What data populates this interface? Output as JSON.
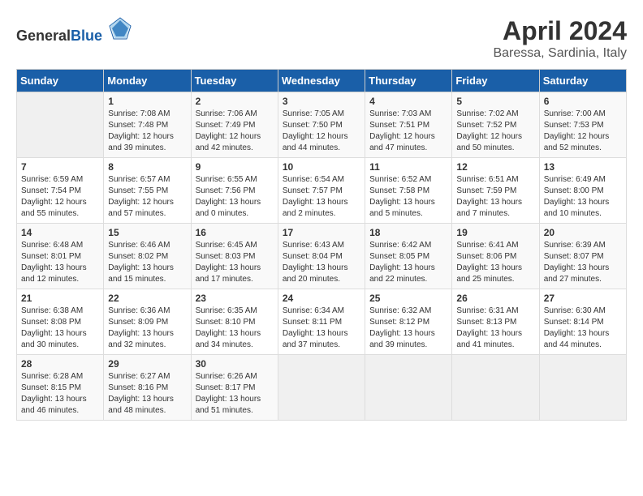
{
  "header": {
    "logo_general": "General",
    "logo_blue": "Blue",
    "month_year": "April 2024",
    "location": "Baressa, Sardinia, Italy"
  },
  "weekdays": [
    "Sunday",
    "Monday",
    "Tuesday",
    "Wednesday",
    "Thursday",
    "Friday",
    "Saturday"
  ],
  "weeks": [
    [
      {
        "day": "",
        "sunrise": "",
        "sunset": "",
        "daylight": ""
      },
      {
        "day": "1",
        "sunrise": "Sunrise: 7:08 AM",
        "sunset": "Sunset: 7:48 PM",
        "daylight": "Daylight: 12 hours and 39 minutes."
      },
      {
        "day": "2",
        "sunrise": "Sunrise: 7:06 AM",
        "sunset": "Sunset: 7:49 PM",
        "daylight": "Daylight: 12 hours and 42 minutes."
      },
      {
        "day": "3",
        "sunrise": "Sunrise: 7:05 AM",
        "sunset": "Sunset: 7:50 PM",
        "daylight": "Daylight: 12 hours and 44 minutes."
      },
      {
        "day": "4",
        "sunrise": "Sunrise: 7:03 AM",
        "sunset": "Sunset: 7:51 PM",
        "daylight": "Daylight: 12 hours and 47 minutes."
      },
      {
        "day": "5",
        "sunrise": "Sunrise: 7:02 AM",
        "sunset": "Sunset: 7:52 PM",
        "daylight": "Daylight: 12 hours and 50 minutes."
      },
      {
        "day": "6",
        "sunrise": "Sunrise: 7:00 AM",
        "sunset": "Sunset: 7:53 PM",
        "daylight": "Daylight: 12 hours and 52 minutes."
      }
    ],
    [
      {
        "day": "7",
        "sunrise": "Sunrise: 6:59 AM",
        "sunset": "Sunset: 7:54 PM",
        "daylight": "Daylight: 12 hours and 55 minutes."
      },
      {
        "day": "8",
        "sunrise": "Sunrise: 6:57 AM",
        "sunset": "Sunset: 7:55 PM",
        "daylight": "Daylight: 12 hours and 57 minutes."
      },
      {
        "day": "9",
        "sunrise": "Sunrise: 6:55 AM",
        "sunset": "Sunset: 7:56 PM",
        "daylight": "Daylight: 13 hours and 0 minutes."
      },
      {
        "day": "10",
        "sunrise": "Sunrise: 6:54 AM",
        "sunset": "Sunset: 7:57 PM",
        "daylight": "Daylight: 13 hours and 2 minutes."
      },
      {
        "day": "11",
        "sunrise": "Sunrise: 6:52 AM",
        "sunset": "Sunset: 7:58 PM",
        "daylight": "Daylight: 13 hours and 5 minutes."
      },
      {
        "day": "12",
        "sunrise": "Sunrise: 6:51 AM",
        "sunset": "Sunset: 7:59 PM",
        "daylight": "Daylight: 13 hours and 7 minutes."
      },
      {
        "day": "13",
        "sunrise": "Sunrise: 6:49 AM",
        "sunset": "Sunset: 8:00 PM",
        "daylight": "Daylight: 13 hours and 10 minutes."
      }
    ],
    [
      {
        "day": "14",
        "sunrise": "Sunrise: 6:48 AM",
        "sunset": "Sunset: 8:01 PM",
        "daylight": "Daylight: 13 hours and 12 minutes."
      },
      {
        "day": "15",
        "sunrise": "Sunrise: 6:46 AM",
        "sunset": "Sunset: 8:02 PM",
        "daylight": "Daylight: 13 hours and 15 minutes."
      },
      {
        "day": "16",
        "sunrise": "Sunrise: 6:45 AM",
        "sunset": "Sunset: 8:03 PM",
        "daylight": "Daylight: 13 hours and 17 minutes."
      },
      {
        "day": "17",
        "sunrise": "Sunrise: 6:43 AM",
        "sunset": "Sunset: 8:04 PM",
        "daylight": "Daylight: 13 hours and 20 minutes."
      },
      {
        "day": "18",
        "sunrise": "Sunrise: 6:42 AM",
        "sunset": "Sunset: 8:05 PM",
        "daylight": "Daylight: 13 hours and 22 minutes."
      },
      {
        "day": "19",
        "sunrise": "Sunrise: 6:41 AM",
        "sunset": "Sunset: 8:06 PM",
        "daylight": "Daylight: 13 hours and 25 minutes."
      },
      {
        "day": "20",
        "sunrise": "Sunrise: 6:39 AM",
        "sunset": "Sunset: 8:07 PM",
        "daylight": "Daylight: 13 hours and 27 minutes."
      }
    ],
    [
      {
        "day": "21",
        "sunrise": "Sunrise: 6:38 AM",
        "sunset": "Sunset: 8:08 PM",
        "daylight": "Daylight: 13 hours and 30 minutes."
      },
      {
        "day": "22",
        "sunrise": "Sunrise: 6:36 AM",
        "sunset": "Sunset: 8:09 PM",
        "daylight": "Daylight: 13 hours and 32 minutes."
      },
      {
        "day": "23",
        "sunrise": "Sunrise: 6:35 AM",
        "sunset": "Sunset: 8:10 PM",
        "daylight": "Daylight: 13 hours and 34 minutes."
      },
      {
        "day": "24",
        "sunrise": "Sunrise: 6:34 AM",
        "sunset": "Sunset: 8:11 PM",
        "daylight": "Daylight: 13 hours and 37 minutes."
      },
      {
        "day": "25",
        "sunrise": "Sunrise: 6:32 AM",
        "sunset": "Sunset: 8:12 PM",
        "daylight": "Daylight: 13 hours and 39 minutes."
      },
      {
        "day": "26",
        "sunrise": "Sunrise: 6:31 AM",
        "sunset": "Sunset: 8:13 PM",
        "daylight": "Daylight: 13 hours and 41 minutes."
      },
      {
        "day": "27",
        "sunrise": "Sunrise: 6:30 AM",
        "sunset": "Sunset: 8:14 PM",
        "daylight": "Daylight: 13 hours and 44 minutes."
      }
    ],
    [
      {
        "day": "28",
        "sunrise": "Sunrise: 6:28 AM",
        "sunset": "Sunset: 8:15 PM",
        "daylight": "Daylight: 13 hours and 46 minutes."
      },
      {
        "day": "29",
        "sunrise": "Sunrise: 6:27 AM",
        "sunset": "Sunset: 8:16 PM",
        "daylight": "Daylight: 13 hours and 48 minutes."
      },
      {
        "day": "30",
        "sunrise": "Sunrise: 6:26 AM",
        "sunset": "Sunset: 8:17 PM",
        "daylight": "Daylight: 13 hours and 51 minutes."
      },
      {
        "day": "",
        "sunrise": "",
        "sunset": "",
        "daylight": ""
      },
      {
        "day": "",
        "sunrise": "",
        "sunset": "",
        "daylight": ""
      },
      {
        "day": "",
        "sunrise": "",
        "sunset": "",
        "daylight": ""
      },
      {
        "day": "",
        "sunrise": "",
        "sunset": "",
        "daylight": ""
      }
    ]
  ]
}
